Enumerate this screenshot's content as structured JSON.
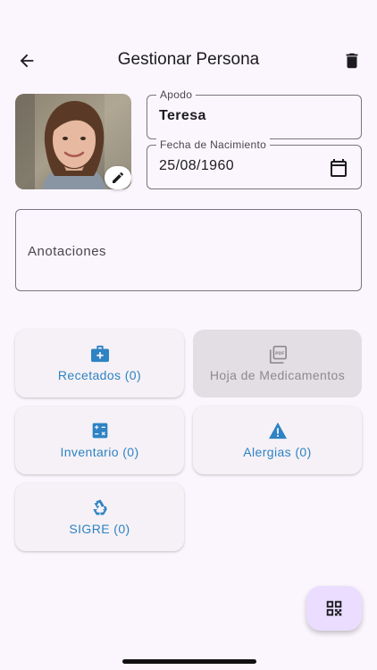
{
  "header": {
    "title": "Gestionar Persona",
    "back_icon": "arrow-left-icon",
    "delete_icon": "trash-icon"
  },
  "profile": {
    "avatar_icon": "person-photo",
    "edit_icon": "pencil-icon"
  },
  "form": {
    "apodo": {
      "label": "Apodo",
      "value": "Teresa"
    },
    "fecha": {
      "label": "Fecha de Nacimiento",
      "value": "25/08/1960",
      "icon": "calendar-icon"
    },
    "anotaciones": {
      "placeholder": "Anotaciones"
    }
  },
  "cards": {
    "recetados": {
      "label": "Recetados (0)",
      "icon": "medkit-icon",
      "enabled": true
    },
    "hoja": {
      "label": "Hoja de Medicamentos",
      "icon": "pdf-stack-icon",
      "enabled": false
    },
    "inventario": {
      "label": "Inventario (0)",
      "icon": "calculator-icon",
      "enabled": true
    },
    "alergias": {
      "label": "Alergias (0)",
      "icon": "warning-icon",
      "enabled": true
    },
    "sigre": {
      "label": "SIGRE (0)",
      "icon": "recycle-icon",
      "enabled": true
    }
  },
  "fab": {
    "icon": "qr-code-icon"
  },
  "colors": {
    "background": "#FBF6FD",
    "accent": "#2D83C4",
    "card": "#F6F1F6",
    "card_disabled": "#E2DEE3",
    "fab": "#EADDFF",
    "outline": "#79747E"
  }
}
